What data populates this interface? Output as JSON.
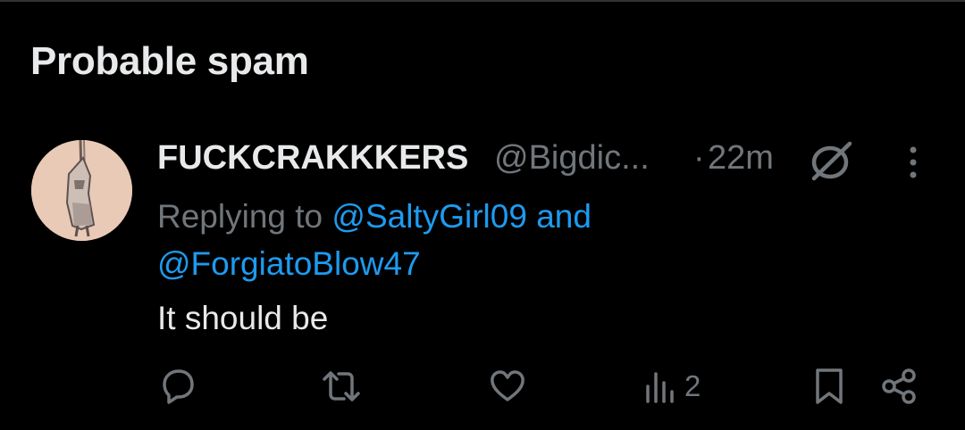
{
  "section": {
    "title": "Probable spam"
  },
  "tweet": {
    "display_name": "FUCKCRAKKKERS",
    "handle": "@Bigdic...",
    "separator": "·",
    "time": "22m",
    "replying_prefix": "Replying to",
    "mention_1": "@SaltyGirl09",
    "conjunction": "and",
    "mention_2": "@ForgiatoBlow47",
    "text": "It should be",
    "views": "2"
  },
  "icons": {
    "avatar": "avatar-image",
    "grok": "grok-slash-icon",
    "more": "more-vertical-icon",
    "reply": "reply-icon",
    "retweet": "retweet-icon",
    "like": "heart-icon",
    "views": "views-icon",
    "bookmark": "bookmark-icon",
    "share": "share-icon"
  },
  "colors": {
    "background": "#000000",
    "primary_text": "#e7e9ea",
    "secondary_text": "#71767b",
    "link": "#1d9bf0"
  }
}
